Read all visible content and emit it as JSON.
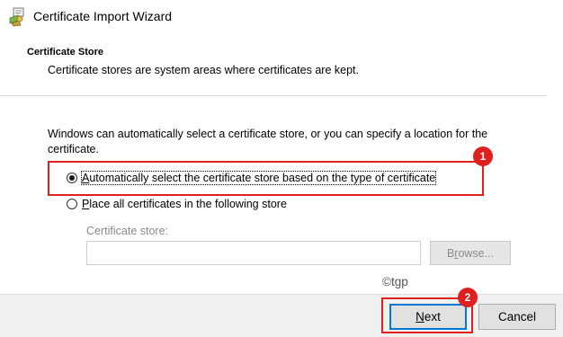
{
  "window": {
    "title": "Certificate Import Wizard",
    "icon": "certificate-wizard-icon"
  },
  "section": {
    "heading": "Certificate Store",
    "description": "Certificate stores are system areas where certificates are kept."
  },
  "body": {
    "instructions": "Windows can automatically select a certificate store, or you can specify a location for the certificate."
  },
  "options": [
    {
      "label": "Automatically select the certificate store based on the type of certificate",
      "mnemonic": "A",
      "checked": true
    },
    {
      "label": "Place all certificates in the following store",
      "mnemonic": "P",
      "checked": false
    }
  ],
  "store": {
    "label": "Certificate store:",
    "value": "",
    "browse_label": "Browse...",
    "browse_mnemonic": "R"
  },
  "watermark": "©tgp",
  "annotations": [
    {
      "number": "1",
      "color": "#e0201f"
    },
    {
      "number": "2",
      "color": "#e0201f"
    }
  ],
  "buttons": {
    "next_label": "Next",
    "next_mnemonic": "N",
    "cancel_label": "Cancel"
  }
}
